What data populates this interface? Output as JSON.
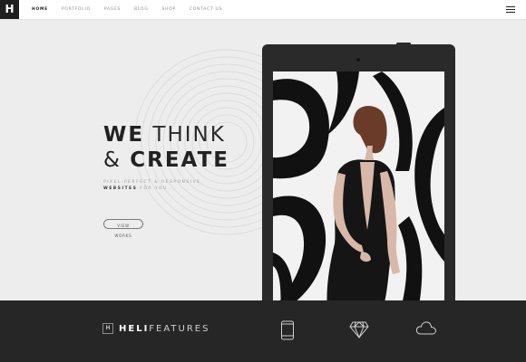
{
  "header": {
    "logo_letter": "H",
    "nav": [
      "Home",
      "Portfolio",
      "Pages",
      "Blog",
      "Shop",
      "Contact Us"
    ],
    "active_index": 0
  },
  "hero": {
    "line1_bold": "WE",
    "line1_light": "THINK",
    "line2_amp": "&",
    "line2_bold": "CREATE",
    "subtitle_line1": "PIXEL-PERFECT & RESPONSIVE",
    "subtitle_line2_bold": "WEBSITES",
    "subtitle_line2_rest": "FOR YOU.",
    "cta_label": "VIEW WORKS"
  },
  "footer": {
    "brand_icon_letter": "H",
    "brand_bold": "HELI",
    "brand_light": "FEATURES",
    "features": [
      "mobile-device-icon",
      "diamond-icon",
      "cloud-icon"
    ]
  },
  "colors": {
    "header_bg": "#ffffff",
    "hero_bg": "#ededed",
    "footer_bg": "#262626",
    "tablet": "#2a2a2a",
    "text_dark": "#222222"
  }
}
